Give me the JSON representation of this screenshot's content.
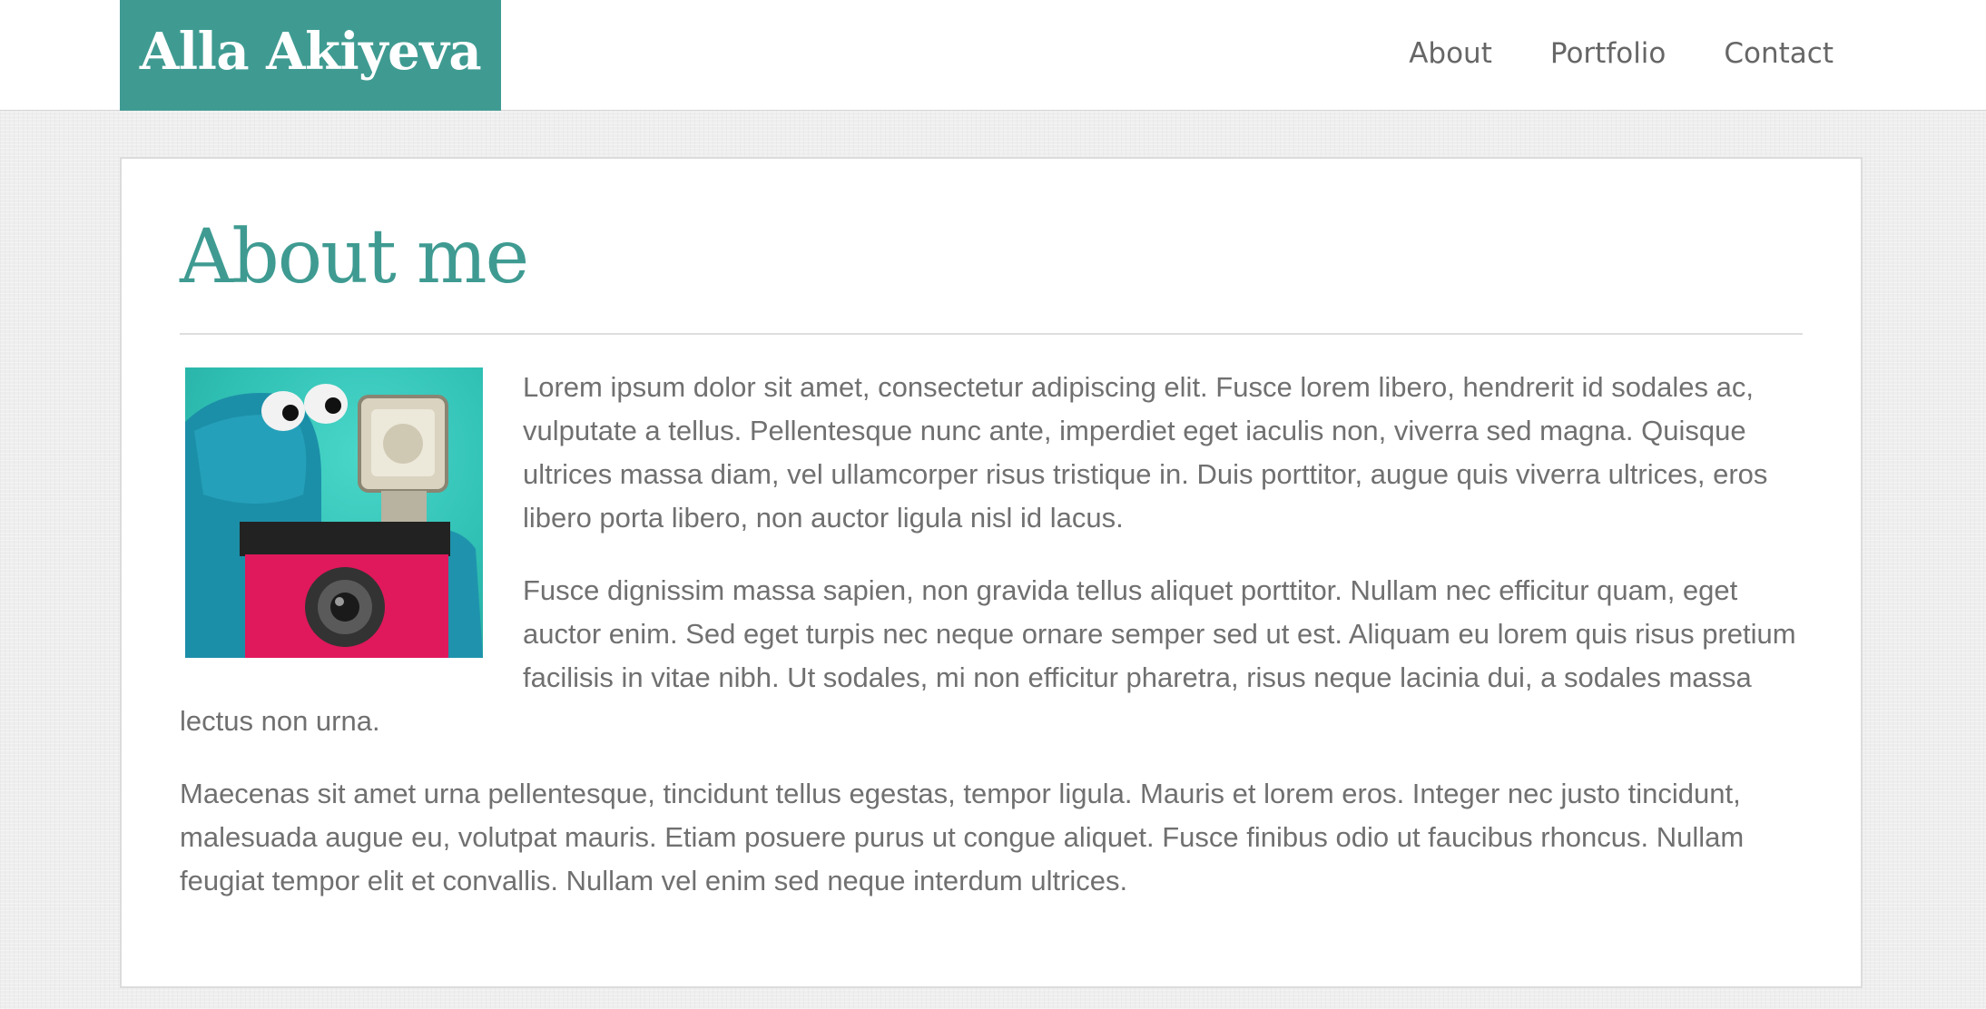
{
  "site": {
    "logo_text": "Alla Akiyeva"
  },
  "nav": {
    "items": [
      {
        "label": "About"
      },
      {
        "label": "Portfolio"
      },
      {
        "label": "Contact"
      }
    ]
  },
  "page": {
    "title": "About me",
    "paragraphs": [
      "Lorem ipsum dolor sit amet, consectetur adipiscing elit. Fusce lorem libero, hendrerit id sodales ac, vulputate a tellus. Pellentesque nunc ante, imperdiet eget iaculis non, viverra sed magna. Quisque ultrices massa diam, vel ullamcorper risus tristique in. Duis porttitor, augue quis viverra ultrices, eros libero porta libero, non auctor ligula nisl id lacus.",
      "Fusce dignissim massa sapien, non gravida tellus aliquet porttitor. Nullam nec efficitur quam, eget auctor enim. Sed eget turpis nec neque ornare semper sed ut est. Aliquam eu lorem quis risus pretium facilisis in vitae nibh. Ut sodales, mi non efficitur pharetra, risus neque lacinia dui, a sodales massa lectus non urna.",
      "Maecenas sit amet urna pellentesque, tincidunt tellus egestas, tempor ligula. Mauris et lorem eros. Integer nec justo tincidunt, malesuada augue eu, volutpat mauris. Etiam posuere purus ut congue aliquet. Fusce finibus odio ut faucibus rhoncus. Nullam feugiat tempor elit et convallis. Nullam vel enim sed neque interdum ultrices."
    ]
  },
  "colors": {
    "accent": "#3f9b92",
    "text": "#707070",
    "nav_text": "#666666"
  }
}
